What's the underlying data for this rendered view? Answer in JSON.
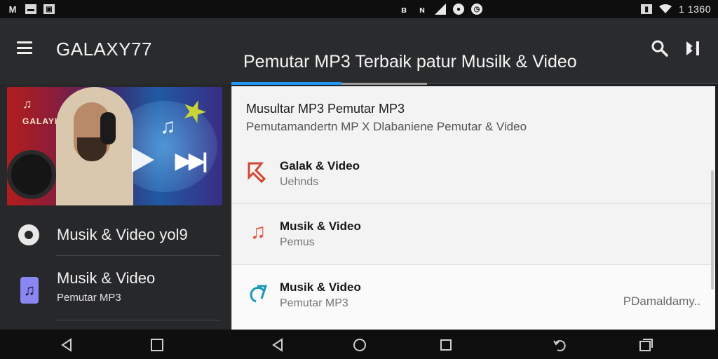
{
  "status_bar": {
    "left_icons": [
      "gmail-icon",
      "mail-box-icon",
      "photo-icon"
    ],
    "left_labels": [
      "M",
      "",
      ""
    ],
    "center_icons": [
      "bluetooth-icon",
      "nfc-icon",
      "signal-triangle-icon",
      "record-icon",
      "alarm-icon"
    ],
    "right_icons": [
      "vibrate-icon",
      "wifi-icon",
      "battery-icon"
    ],
    "time": "1 1360"
  },
  "app_bar": {
    "title": "GALAXY77",
    "heading": "Pemutar MP3 Terbaik patur Musilk & Video"
  },
  "sidebar": {
    "hero": {
      "mark": "♫",
      "text": "GALAYI"
    },
    "items": [
      {
        "label": "Musik & Video yol9",
        "icon": "gear-icon"
      },
      {
        "label": "Musik & Video",
        "sublabel": "Pemutar MP3",
        "icon": "music-note-tile-icon"
      }
    ]
  },
  "panel": {
    "header": "Musultar MP3 Pemutar MP3",
    "subheader": "Pemutamandertn MP X Dlabaniene Pemutar & Video",
    "rows": [
      {
        "title": "Galak & Video",
        "subtitle": "Uehnds",
        "icon": "tools-icon",
        "icon_color": "#d64533"
      },
      {
        "title": "Musik & Video",
        "subtitle": "Pemus",
        "icon": "music-note-icon",
        "icon_color": "#e0583a"
      },
      {
        "title": "Musik & Video",
        "subtitle": "Pemutar MP3",
        "icon": "music-circle-icon",
        "icon_color": "#1a9ab8",
        "right_text": "PDamaldamy.."
      }
    ]
  },
  "colors": {
    "accent": "#2196f3",
    "app_bar": "#2a2b2d",
    "panel": "#f3f3f4"
  },
  "navbar": {
    "buttons": [
      "back-icon",
      "home-square-icon",
      "back-icon",
      "home-circle-icon",
      "recents-square-icon",
      "rotate-icon",
      "overview-icon"
    ]
  }
}
